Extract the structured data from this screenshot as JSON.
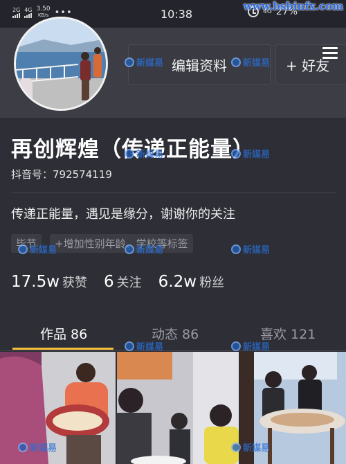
{
  "status_bar": {
    "signal1": "2G",
    "signal2": "4G",
    "net_speed": "3.50",
    "net_unit": "KB/s",
    "dots": "•••",
    "time": "10:38",
    "net_type": "4G",
    "battery": "27%"
  },
  "watermark": {
    "url": "www.bsbinfx.com",
    "logo_text": "新媒易"
  },
  "profile": {
    "edit_button": "编辑资料",
    "add_friend_button": "+ 好友",
    "name": "再创辉煌（传递正能量）",
    "douyin_id": "抖音号：792574119",
    "bio": "传递正能量，遇见是缘分，谢谢你的关注",
    "tag_location": "毕节",
    "tag_add": "+增加性别年龄、学校等标签"
  },
  "stats": [
    {
      "value": "17.5w",
      "label": "获赞"
    },
    {
      "value": "6",
      "label": "关注"
    },
    {
      "value": "6.2w",
      "label": "粉丝"
    }
  ],
  "tabs": {
    "works": "作品 86",
    "dynamic": "动态 86",
    "likes": "喜欢 121"
  },
  "colors": {
    "accent": "#f5c33b",
    "background": "#2d2e36"
  }
}
